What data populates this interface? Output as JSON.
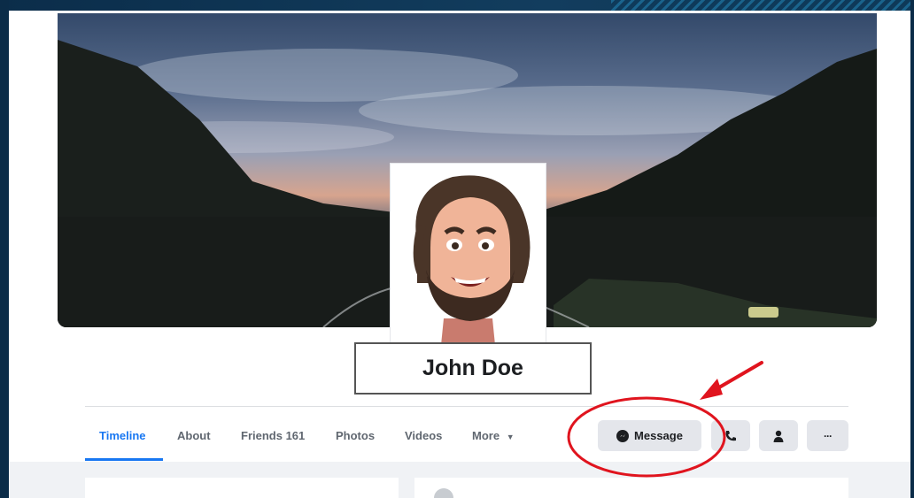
{
  "profile": {
    "name": "John Doe"
  },
  "tabs": [
    {
      "label": "Timeline",
      "active": true
    },
    {
      "label": "About"
    },
    {
      "label": "Friends 161"
    },
    {
      "label": "Photos"
    },
    {
      "label": "Videos"
    },
    {
      "label": "More"
    }
  ],
  "actions": {
    "message_label": "Message",
    "message_icon": "messenger-icon",
    "call_icon": "phone-icon",
    "friend_icon": "person-icon",
    "more_label": "···"
  },
  "colors": {
    "accent": "#1877f2",
    "annotation": "#e0141e"
  }
}
